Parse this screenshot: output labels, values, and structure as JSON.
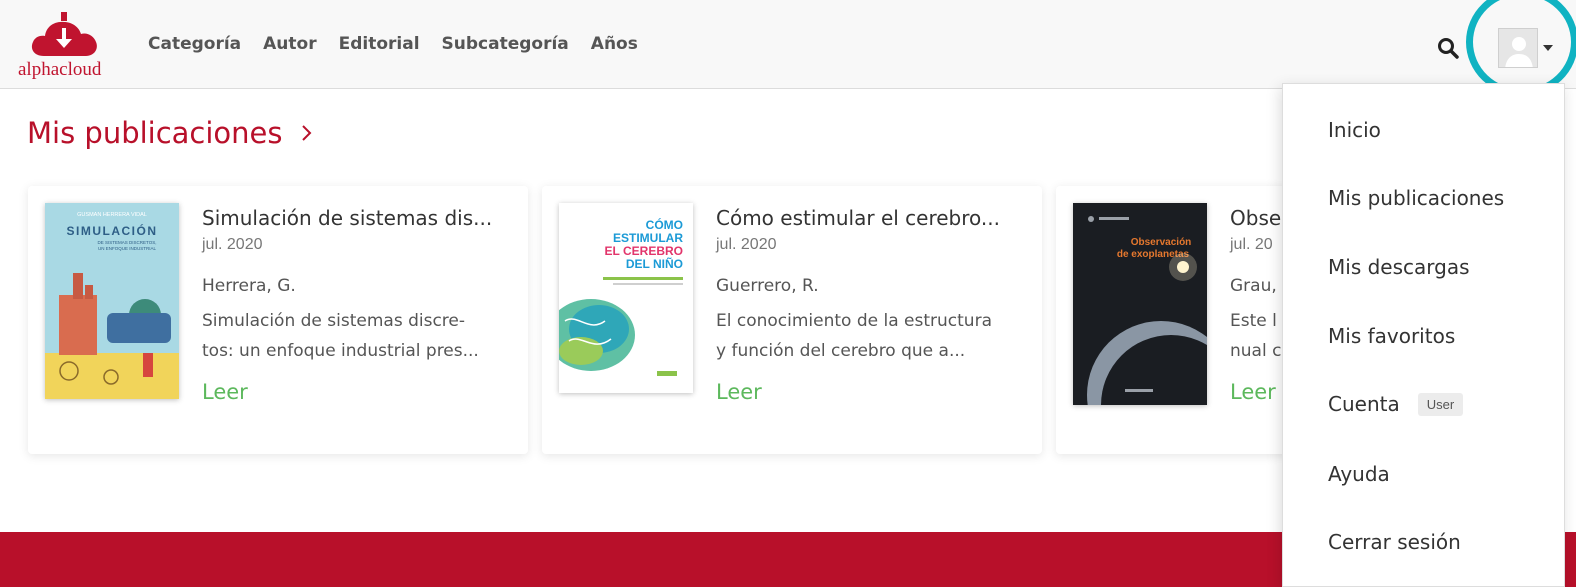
{
  "brand": {
    "name": "alphacloud",
    "color": "#c0142f"
  },
  "nav": {
    "links": [
      "Categoría",
      "Autor",
      "Editorial",
      "Subcategoría",
      "Años"
    ]
  },
  "section": {
    "title": "Mis publicaciones"
  },
  "cards": [
    {
      "title": "Simulación de sistemas dis...",
      "date": "jul. 2020",
      "author": "Herrera, G.",
      "desc1": "Simulación de sistemas discre-",
      "desc2": "tos: un enfoque industrial pres...",
      "read": "Leer",
      "cover_header": "GUSMAN HERRERA VIDAL",
      "cover_title": "SIMULACIÓN",
      "cover_sub1": "DE SISTEMAS DISCRETOS,",
      "cover_sub2": "UN ENFOQUE INDUSTRIAL"
    },
    {
      "title": "Cómo estimular el cerebro...",
      "date": "jul. 2020",
      "author": "Guerrero, R.",
      "desc1": "El conocimiento de la estructura",
      "desc2": "y función del cerebro que a...",
      "read": "Leer",
      "cover_l1": "CÓMO",
      "cover_l2": "ESTIMULAR",
      "cover_l3": "EL CEREBRO",
      "cover_l4": "DEL NIÑO"
    },
    {
      "title": "Obse",
      "date": "jul. 20",
      "author": "Grau,",
      "desc1": "Este l",
      "desc2": "nual c",
      "read": "Leer",
      "cover_l1": "Observación",
      "cover_l2": "de exoplanetas"
    }
  ],
  "dropdown": {
    "items": [
      "Inicio",
      "Mis publicaciones",
      "Mis descargas",
      "Mis favoritos",
      "Cuenta",
      "Ayuda",
      "Cerrar sesión"
    ],
    "account_badge": "User"
  },
  "colors": {
    "accent": "#b8102a",
    "read_link": "#5cb85c",
    "highlight": "#10b3c2"
  }
}
